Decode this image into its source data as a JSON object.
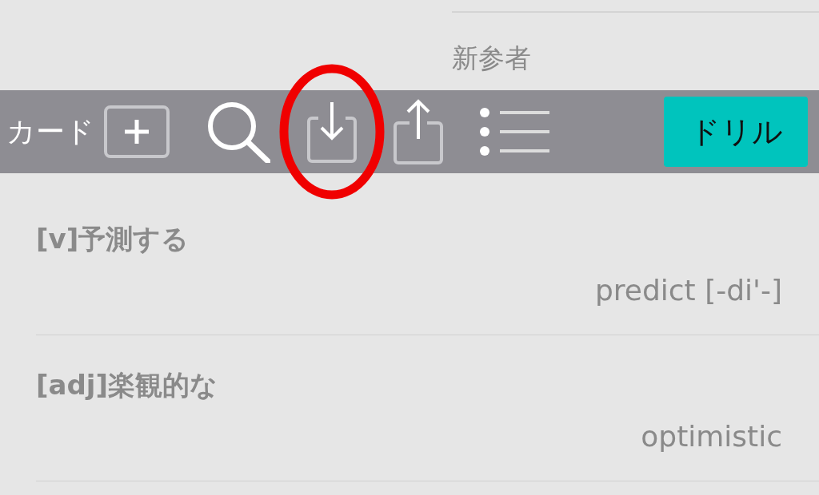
{
  "header": {
    "label": "新参者"
  },
  "toolbar": {
    "title": "カード",
    "tools": [
      {
        "kind": "add",
        "highlighted": false
      },
      {
        "kind": "search",
        "highlighted": false
      },
      {
        "kind": "import",
        "highlighted": true
      },
      {
        "kind": "export",
        "highlighted": false
      },
      {
        "kind": "list",
        "highlighted": false
      }
    ],
    "drill_button": "ドリル"
  },
  "cards": [
    {
      "front": "[v]予測する",
      "back": "predict [-di'-]"
    },
    {
      "front": "[adj]楽観的な",
      "back": "optimistic"
    }
  ]
}
